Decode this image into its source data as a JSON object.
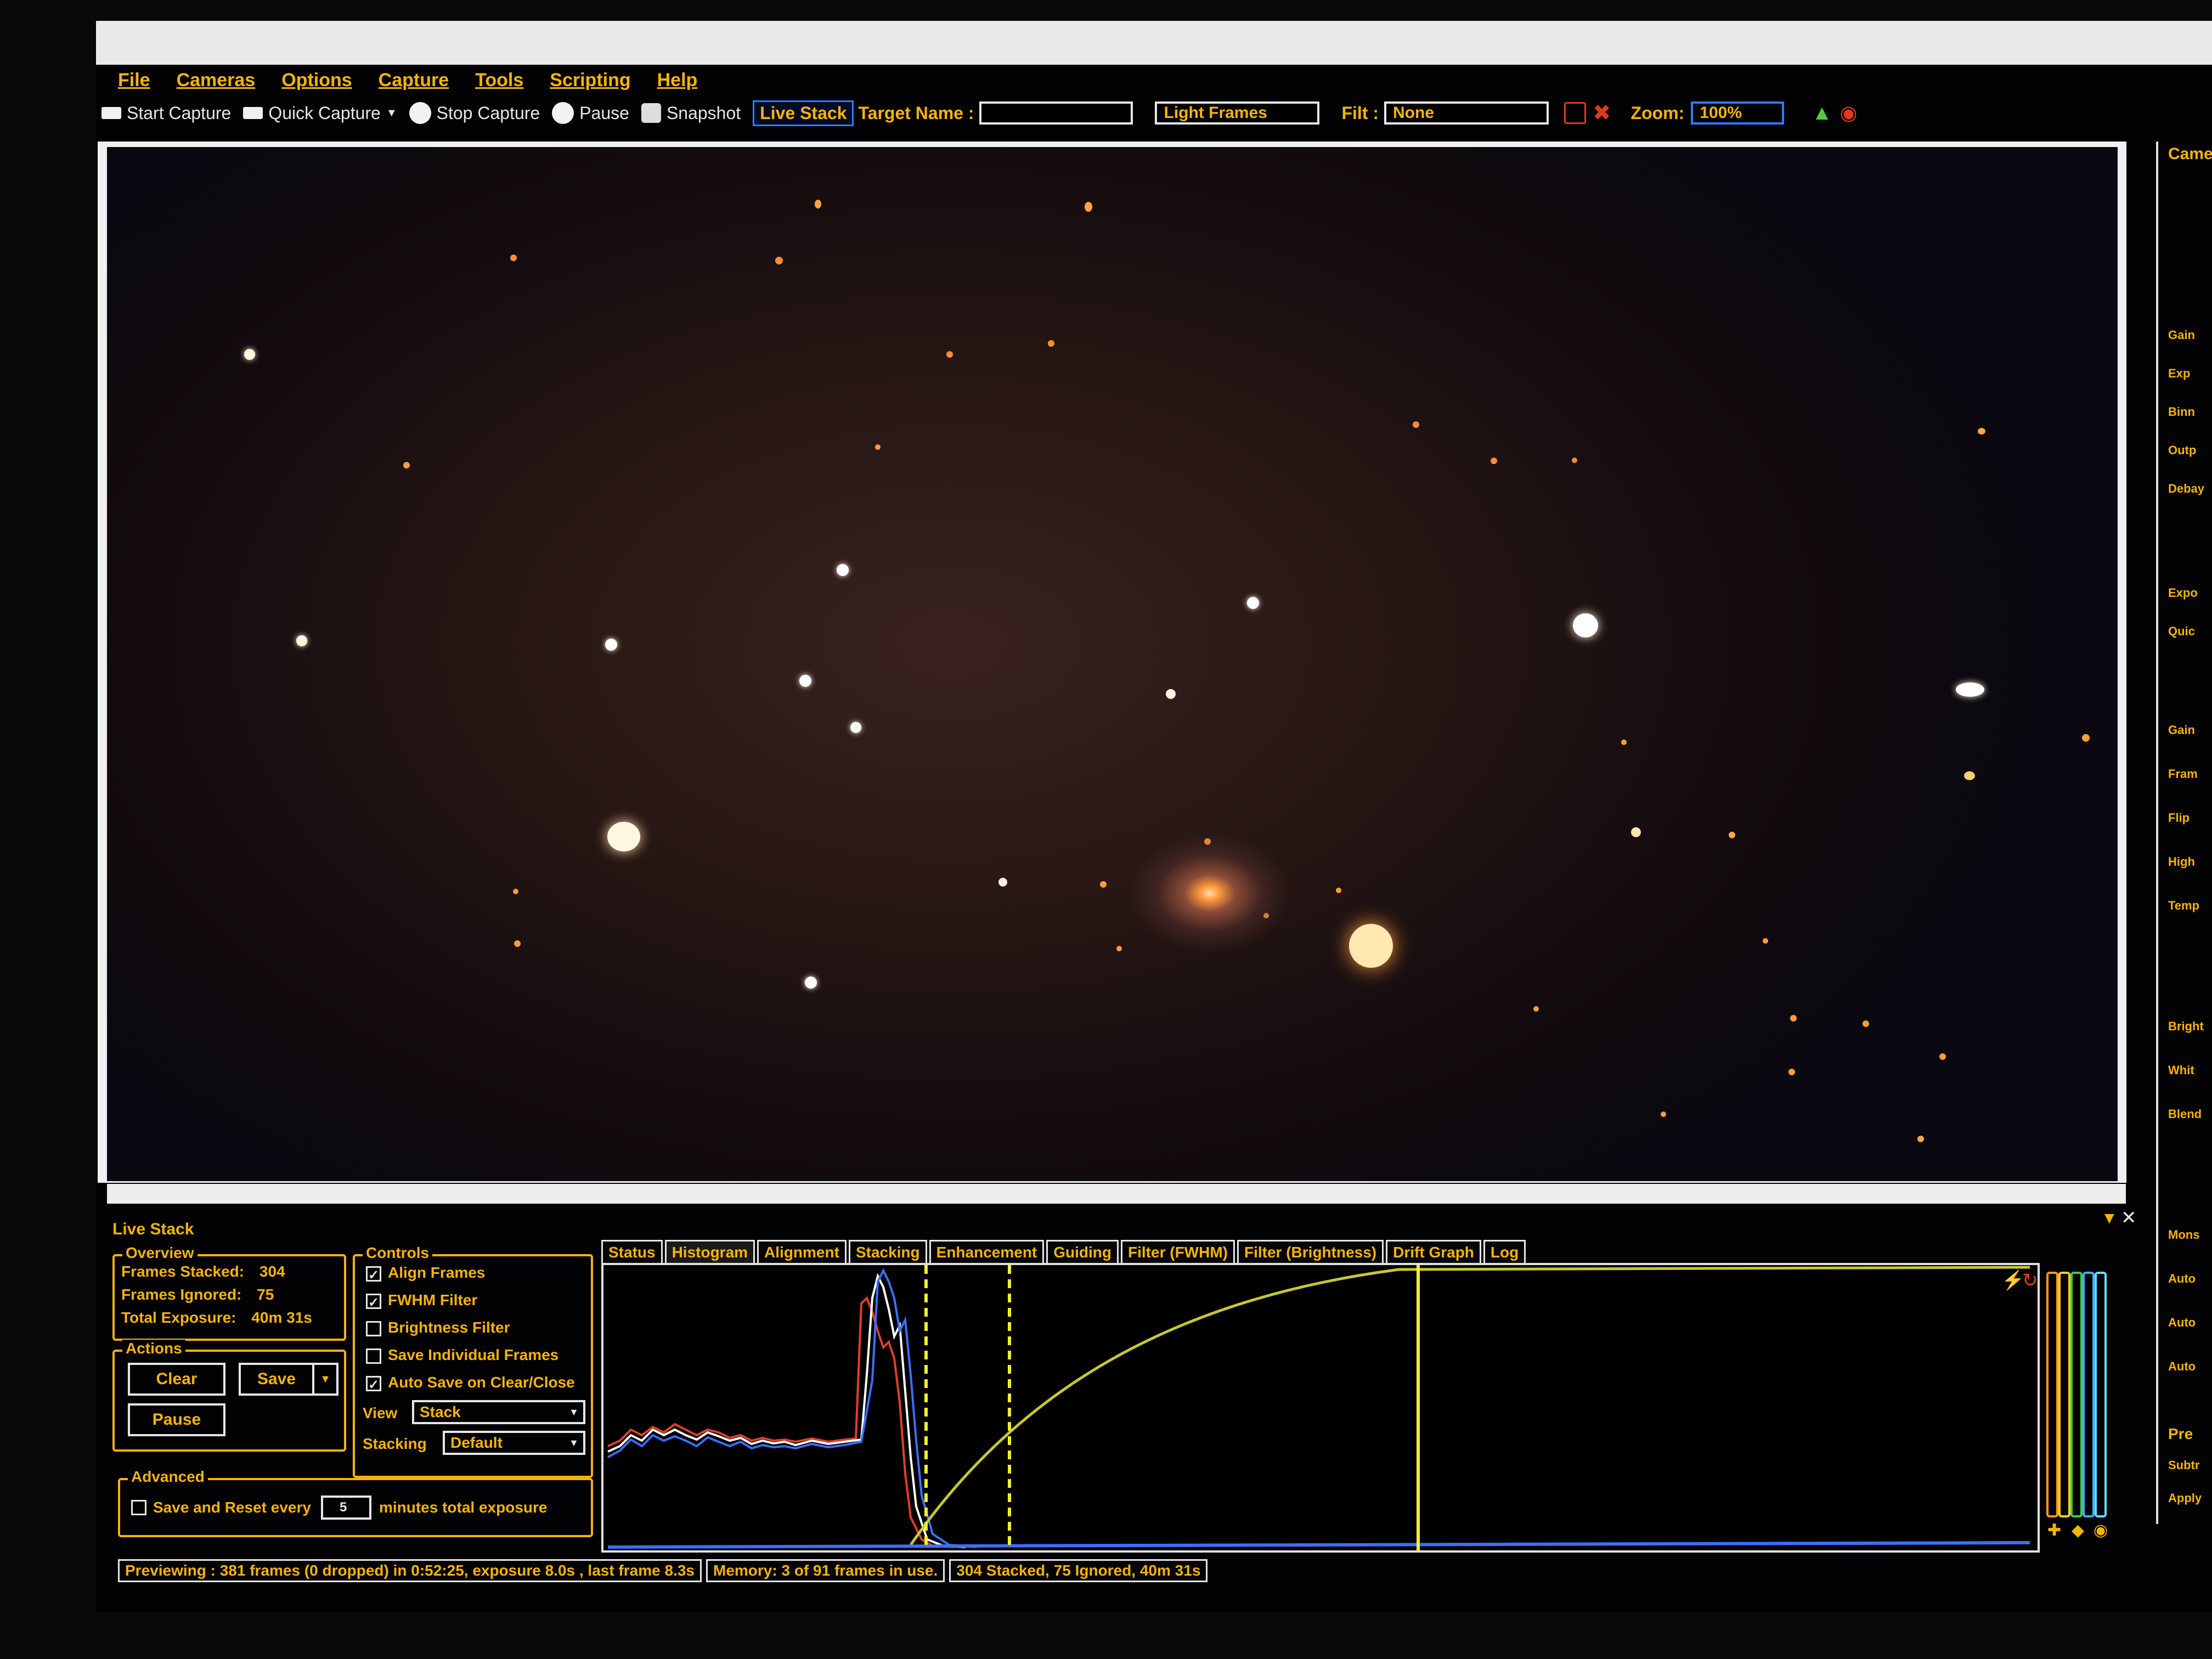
{
  "menu": [
    "File",
    "Cameras",
    "Options",
    "Capture",
    "Tools",
    "Scripting",
    "Help"
  ],
  "toolbar": {
    "start_capture": "Start Capture",
    "quick_capture": "Quick Capture",
    "stop_capture": "Stop Capture",
    "pause": "Pause",
    "snapshot": "Snapshot",
    "live_stack": "Live Stack",
    "target_name_label": "Target Name :",
    "target_name_value": "",
    "frame_type": "Light Frames",
    "filter_label": "Filt :",
    "filter_value": "None",
    "zoom_label": "Zoom:",
    "zoom_value": "100%"
  },
  "right_panel": {
    "title": "Came",
    "labels": [
      "Gain",
      "Exp",
      "Binn",
      "Outp",
      "Debay",
      "Expo",
      "Quic",
      "Gain",
      "Fram",
      "Flip",
      "High",
      "Temp",
      "Bright",
      "Whit",
      "Blend",
      "Mons",
      "Auto",
      "Auto",
      "Auto",
      "Pre",
      "Subtr",
      "Apply"
    ]
  },
  "live_stack": {
    "title": "Live Stack",
    "overview": {
      "title": "Overview",
      "frames_stacked_label": "Frames Stacked:",
      "frames_stacked_value": "304",
      "frames_ignored_label": "Frames Ignored:",
      "frames_ignored_value": "75",
      "total_exposure_label": "Total Exposure:",
      "total_exposure_value": "40m 31s"
    },
    "actions": {
      "title": "Actions",
      "clear": "Clear",
      "save": "Save",
      "pause": "Pause"
    },
    "controls": {
      "title": "Controls",
      "align_frames": "Align Frames",
      "fwhm_filter": "FWHM Filter",
      "brightness_filter": "Brightness Filter",
      "save_individual": "Save Individual Frames",
      "auto_save": "Auto Save on Clear/Close",
      "view_label": "View",
      "view_value": "Stack",
      "stacking_label": "Stacking",
      "stacking_value": "Default"
    },
    "advanced": {
      "title": "Advanced",
      "save_reset_label": "Save and Reset every",
      "save_reset_value": "5",
      "save_reset_suffix": "minutes total exposure"
    },
    "tabs": [
      "Status",
      "Histogram",
      "Alignment",
      "Stacking",
      "Enhancement",
      "Guiding",
      "Filter (FWHM)",
      "Filter (Brightness)",
      "Drift Graph",
      "Log"
    ],
    "active_tab": "Histogram"
  },
  "status_bar": {
    "previewing": "Previewing : 381 frames (0 dropped) in 0:52:25, exposure 8.0s , last frame 8.3s",
    "memory": "Memory: 3 of 91 frames in use.",
    "stack_summary": "304 Stacked, 75 Ignored, 40m 31s"
  },
  "colors": {
    "accent": "#f5b40a",
    "highlight": "#2a7fff"
  }
}
